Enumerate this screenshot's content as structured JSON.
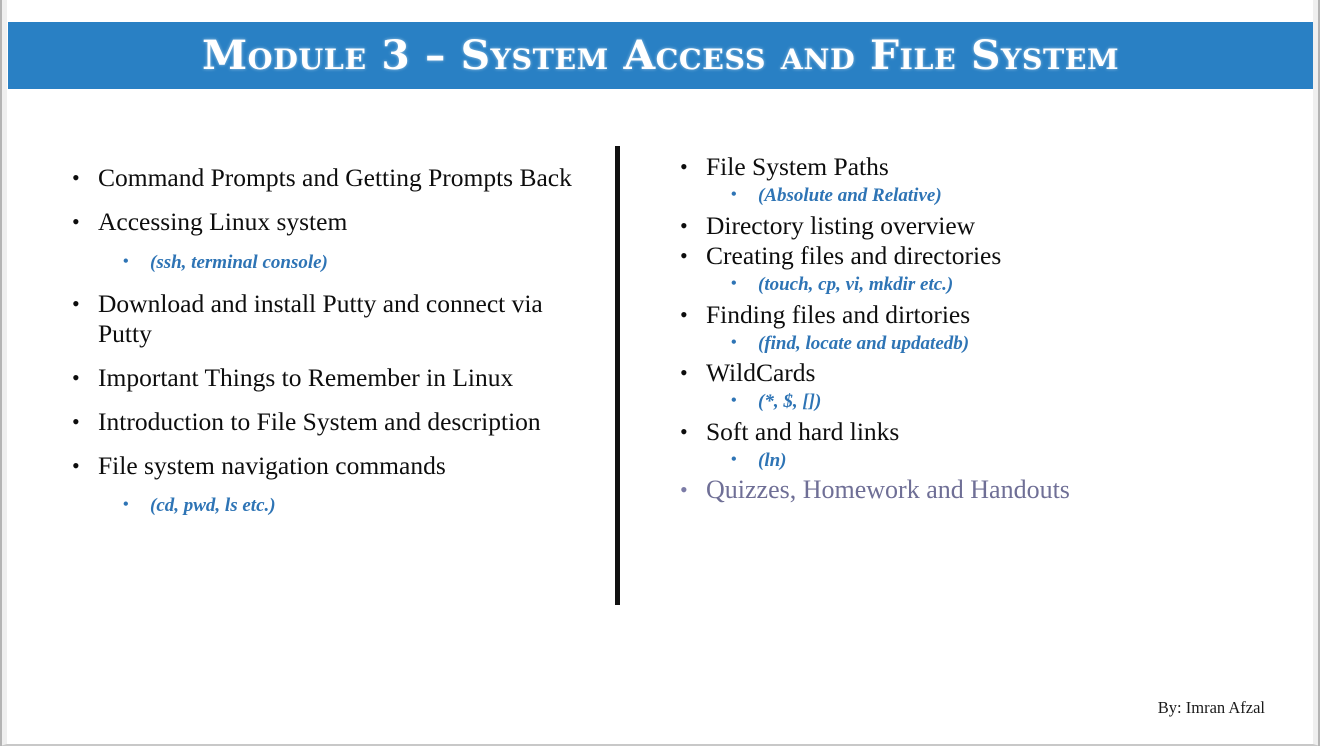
{
  "slide": {
    "title": "Module 3 – System Access and File System",
    "banner_color": "#2980c4",
    "title_color": "#ffffff",
    "subbullet_color": "#2e74b5",
    "accent_color": "#6f6f96",
    "bullet_glyph": "•",
    "footer": "By: Imran Afzal"
  },
  "left_column": {
    "items": [
      {
        "text": "Command Prompts and Getting Prompts Back",
        "subs": []
      },
      {
        "text": "Accessing Linux system",
        "subs": [
          "(ssh, terminal console)"
        ]
      },
      {
        "text": "Download and install Putty and connect via Putty",
        "subs": []
      },
      {
        "text": "Important Things to Remember in Linux",
        "subs": []
      },
      {
        "text": "Introduction to File System and description",
        "subs": []
      },
      {
        "text": "File system navigation commands",
        "subs": [
          "(cd, pwd, ls etc.)"
        ]
      }
    ]
  },
  "right_column": {
    "items": [
      {
        "text": "File System Paths",
        "subs": [
          "(Absolute and Relative)"
        ]
      },
      {
        "text": "Directory listing overview",
        "subs": []
      },
      {
        "text": "Creating files and directories",
        "subs": [
          "(touch, cp, vi, mkdir etc.)"
        ]
      },
      {
        "text": "Finding files and dirtories",
        "subs": [
          "(find, locate and updatedb)"
        ]
      },
      {
        "text": "WildCards",
        "subs": [
          "(*, $, [])"
        ]
      },
      {
        "text": "Soft and hard links",
        "subs": [
          "(ln)"
        ]
      },
      {
        "text": "Quizzes, Homework and Handouts",
        "subs": [],
        "accent": true
      }
    ]
  }
}
